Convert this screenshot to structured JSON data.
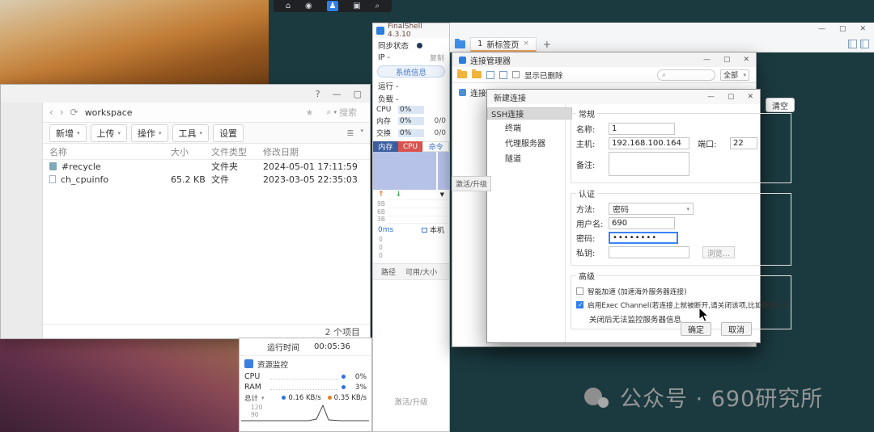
{
  "desktop": {
    "watermark": "公众号 · 690研究所"
  },
  "icons": {
    "home": "⌂",
    "globe": "◉",
    "users": "♟",
    "monitor": "▣",
    "search": "⌕",
    "help": "?",
    "minimize": "—",
    "maximize": "▢",
    "close": "✕",
    "back": "‹",
    "forward": "›",
    "refresh": "⟳",
    "star": "★",
    "caret": "▾",
    "list": "≣",
    "plus": "+",
    "tab_close": "×",
    "up": "↑",
    "down": "↓",
    "dropdown": "▼"
  },
  "file_manager": {
    "breadcrumb": "workspace",
    "search_placeholder": "搜索",
    "toolbar": [
      "新增",
      "上传",
      "操作",
      "工具",
      "设置"
    ],
    "columns": [
      "名称",
      "大小",
      "文件类型",
      "修改日期"
    ],
    "rows": [
      {
        "name": "#recycle",
        "size": "",
        "type": "文件夹",
        "date": "2024-05-01 17:11:59"
      },
      {
        "name": "ch_cpuinfo",
        "size": "65.2 KB",
        "type": "文件",
        "date": "2023-03-05 22:35:03"
      }
    ],
    "status": "2 个项目"
  },
  "monitor_panel": {
    "title": "FinalShell 4.3.10",
    "sync_status": "同步状态",
    "ip_label": "IP  -",
    "copy": "复制",
    "system_info": "系统信息",
    "run": "运行 -",
    "load": "负载 -",
    "stats": [
      {
        "label": "CPU",
        "percent": "0%",
        "ratio": ""
      },
      {
        "label": "内存",
        "percent": "0%",
        "ratio": "0/0"
      },
      {
        "label": "交换",
        "percent": "0%",
        "ratio": "0/0"
      }
    ],
    "tabs": [
      "内存",
      "CPU",
      "命令"
    ],
    "net_scale": [
      "9B",
      "6B",
      "3B"
    ],
    "ping": "0ms",
    "host_local": "本机",
    "ping_scale": [
      "0",
      "0",
      "0"
    ],
    "disk_columns": [
      "路径",
      "可用/大小"
    ],
    "activate": "激活/升级"
  },
  "main_window": {
    "tab_count": "1",
    "tab_title": "新标签页",
    "clear_button": "清空"
  },
  "connection_manager": {
    "title": "连接管理器",
    "show_deleted": "显示已删除",
    "filter_all": "全部",
    "tree_root": "连接",
    "activate": "激活/升级"
  },
  "new_connection": {
    "title": "新建连接",
    "tree": [
      "SSH连接",
      "终端",
      "代理服务器",
      "隧道"
    ],
    "sections": {
      "general": "常规",
      "auth": "认证",
      "advanced": "高级"
    },
    "fields": {
      "name_label": "名称:",
      "name_value": "1",
      "host_label": "主机:",
      "host_value": "192.168.100.164",
      "port_label": "端口:",
      "port_value": "22",
      "remark_label": "备注:",
      "method_label": "方法:",
      "method_value": "密码",
      "user_label": "用户名:",
      "user_value": "690",
      "password_label": "密码:",
      "password_value": "••••••••",
      "key_label": "私钥:",
      "browse": "浏览..."
    },
    "advanced_options": [
      {
        "label": "智能加速 (加速海外服务器连接)",
        "checked": false
      },
      {
        "label": "启用Exec Channel(若连接上就被断开,请关闭该项,比如跳板机)",
        "checked": true
      }
    ],
    "advanced_note": "关闭后无法监控服务器信息",
    "ok": "确定",
    "cancel": "取消"
  },
  "resource_monitor": {
    "uptime_label": "运行时间",
    "uptime_value": "00:05:36",
    "title": "资源监控",
    "rows": [
      {
        "label": "CPU",
        "value": "0%"
      },
      {
        "label": "RAM",
        "value": "3%"
      }
    ],
    "total_label": "总计",
    "up_speed": "0.16 KB/s",
    "down_speed": "0.35 KB/s",
    "chart_scale": [
      "120",
      "90"
    ]
  }
}
